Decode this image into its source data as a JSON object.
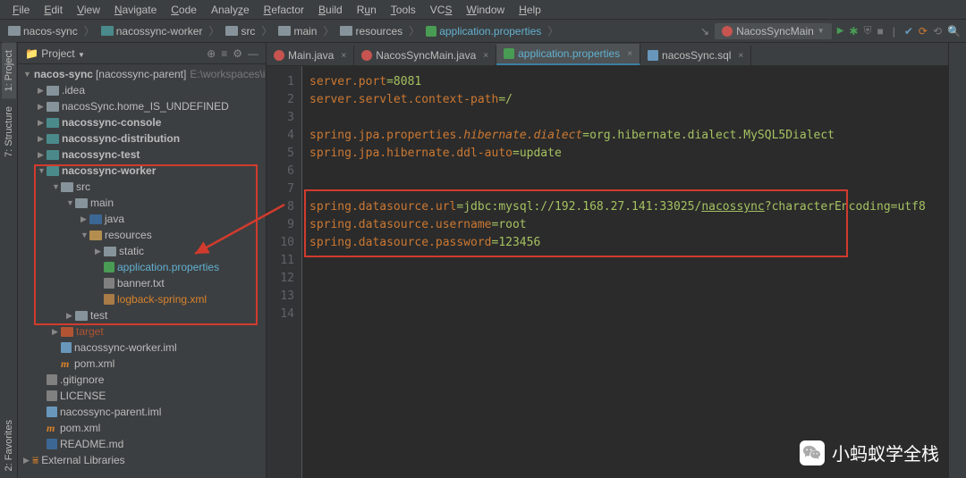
{
  "menu": [
    "File",
    "Edit",
    "View",
    "Navigate",
    "Code",
    "Analyze",
    "Refactor",
    "Build",
    "Run",
    "Tools",
    "VCS",
    "Window",
    "Help"
  ],
  "breadcrumb": {
    "items": [
      "nacos-sync",
      "nacossync-worker",
      "src",
      "main",
      "resources",
      "application.properties"
    ]
  },
  "run_config": {
    "name": "NacosSyncMain",
    "play": "▶"
  },
  "project": {
    "title": "Project",
    "root": "nacos-sync",
    "root_suffix": "[nacossync-parent]",
    "root_path": "E:\\workspaces\\idea\\n",
    "items": {
      "idea": ".idea",
      "home": "nacosSync.home_IS_UNDEFINED",
      "console": "nacossync-console",
      "distribution": "nacossync-distribution",
      "test": "nacossync-test",
      "worker": "nacossync-worker",
      "src": "src",
      "main": "main",
      "java": "java",
      "resources": "resources",
      "static": "static",
      "app_prop": "application.properties",
      "banner": "banner.txt",
      "logback": "logback-spring.xml",
      "testf": "test",
      "target": "target",
      "worker_iml": "nacossync-worker.iml",
      "pom1": "pom.xml",
      "gitignore": ".gitignore",
      "license": "LICENSE",
      "parent_iml": "nacossync-parent.iml",
      "pom2": "pom.xml",
      "readme": "README.md",
      "extlib": "External Libraries"
    }
  },
  "tabs": [
    {
      "label": "Main.java",
      "icon": "java"
    },
    {
      "label": "NacosSyncMain.java",
      "icon": "java"
    },
    {
      "label": "application.properties",
      "icon": "prop",
      "active": true
    },
    {
      "label": "nacosSync.sql",
      "icon": "sql"
    }
  ],
  "code": {
    "lines": [
      {
        "k": "server.port",
        "op": "=",
        "v": "8081"
      },
      {
        "k": "server.servlet.context-path",
        "op": "=",
        "v": "/"
      },
      {
        "blank": true
      },
      {
        "k": "spring.jpa.properties.",
        "ki": "hibernate.dialect",
        "op": "=",
        "v": "org.hibernate.dialect.MySQL5Dialect"
      },
      {
        "k": "spring.jpa.hibernate.ddl-auto",
        "op": "=",
        "v": "update"
      },
      {
        "blank": true
      },
      {
        "blank": true
      },
      {
        "k": "spring.datasource.url",
        "op": "=",
        "v": "jdbc:mysql://192.168.27.141:33025/",
        "vu": "nacossync",
        "v2": "?characterEncoding=utf8"
      },
      {
        "k": "spring.datasource.username",
        "op": "=",
        "v": "root"
      },
      {
        "k": "spring.datasource.password",
        "op": "=",
        "v": "123456"
      },
      {
        "blank": true
      },
      {
        "blank": true
      },
      {
        "blank": true
      },
      {
        "blank": true
      }
    ]
  },
  "watermark": "小蚂蚁学全栈",
  "left_tabs": [
    "Project",
    "Structure",
    "Favorites"
  ]
}
